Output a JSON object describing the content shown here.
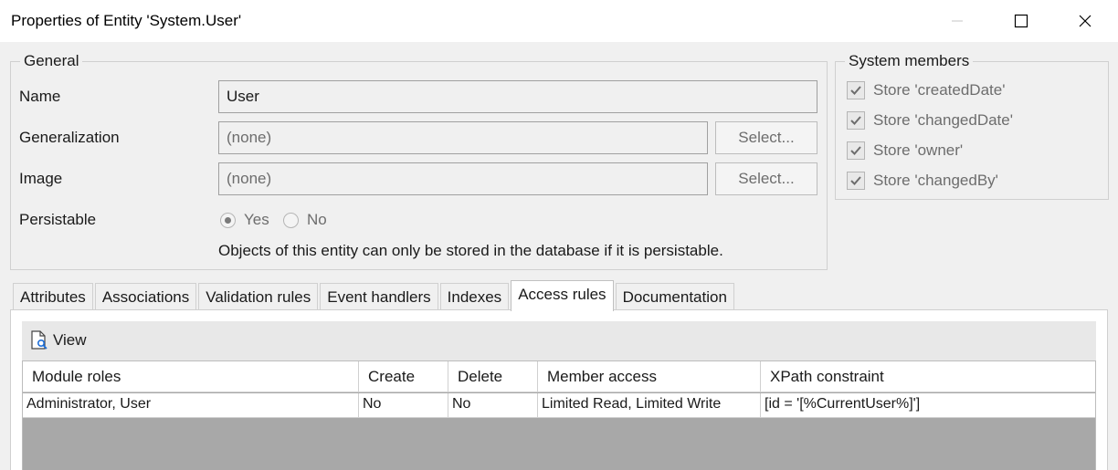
{
  "window": {
    "title": "Properties of Entity 'System.User'"
  },
  "general": {
    "legend": "General",
    "name_label": "Name",
    "name_value": "User",
    "generalization_label": "Generalization",
    "generalization_value": "(none)",
    "generalization_button": "Select...",
    "image_label": "Image",
    "image_value": "(none)",
    "image_button": "Select...",
    "persistable_label": "Persistable",
    "persistable_yes": "Yes",
    "persistable_no": "No",
    "persistable_selected": "Yes",
    "hint": "Objects of this entity can only be stored in the database if it is persistable."
  },
  "system_members": {
    "legend": "System members",
    "items": [
      {
        "label": "Store 'createdDate'",
        "checked": true
      },
      {
        "label": "Store 'changedDate'",
        "checked": true
      },
      {
        "label": "Store 'owner'",
        "checked": true
      },
      {
        "label": "Store 'changedBy'",
        "checked": true
      }
    ]
  },
  "tabs": [
    {
      "label": "Attributes"
    },
    {
      "label": "Associations"
    },
    {
      "label": "Validation rules"
    },
    {
      "label": "Event handlers"
    },
    {
      "label": "Indexes"
    },
    {
      "label": "Access rules",
      "active": true
    },
    {
      "label": "Documentation"
    }
  ],
  "access_rules": {
    "view_button": "View",
    "columns": [
      "Module roles",
      "Create",
      "Delete",
      "Member access",
      "XPath constraint"
    ],
    "rows": [
      [
        "Administrator, User",
        "No",
        "No",
        "Limited Read, Limited Write",
        "[id = '[%CurrentUser%]']"
      ]
    ]
  },
  "icons": {
    "minimize": "minimize-icon",
    "maximize": "maximize-icon",
    "close": "close-icon",
    "view": "document-search-icon",
    "check": "checkmark-icon"
  },
  "colors": {
    "background": "#f0f0f0",
    "grid_empty": "#a8a8a8",
    "disabled_text": "#6d6d6d"
  }
}
